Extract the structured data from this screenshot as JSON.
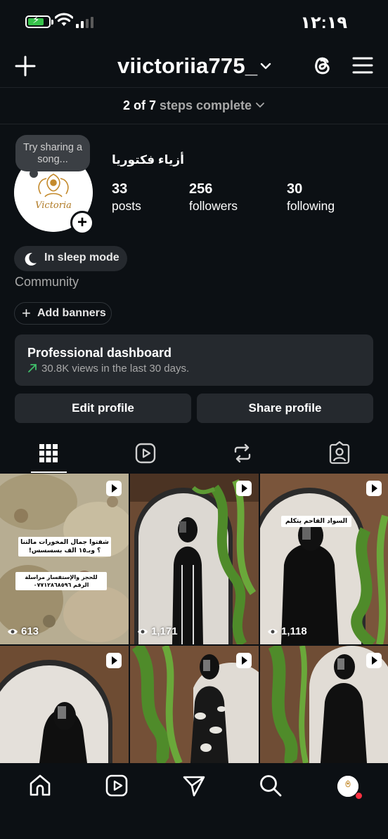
{
  "status_bar": {
    "time": "١٢:١٩"
  },
  "header": {
    "username": "viictoriia775_"
  },
  "steps": {
    "progress": "2 of 7",
    "suffix": "steps complete"
  },
  "profile": {
    "note": "Try sharing a song...",
    "logo_text": "Victoria",
    "full_name": "أزياء فكتوريا",
    "stats": [
      {
        "value": "33",
        "label": "posts"
      },
      {
        "value": "256",
        "label": "followers"
      },
      {
        "value": "30",
        "label": "following"
      }
    ],
    "sleep_mode": "In sleep mode",
    "category": "Community",
    "add_banners": "Add banners"
  },
  "dashboard": {
    "title": "Professional dashboard",
    "subtitle": "30.8K views in the last 30 days."
  },
  "buttons": {
    "edit": "Edit profile",
    "share": "Share profile"
  },
  "posts": [
    {
      "views": "613",
      "caption1": "شفتوا جمال المخورات مالتنا ؟ وبـ١٥ الف بسسسس!",
      "caption2": "للحجز والإستفسار مراسلة الرقم ٠٧٧١٢٨٦٨٥٩٦"
    },
    {
      "views": "1,171"
    },
    {
      "views": "1,118",
      "caption1": "السواد الفاحم يتكلم"
    },
    {
      "views": ""
    },
    {
      "views": ""
    },
    {
      "views": ""
    }
  ],
  "colors": {
    "background": "#0c1014",
    "surface": "#25292e",
    "accent_green": "#37c24b",
    "trend_green": "#3fbf6a",
    "notification": "#ff3040"
  }
}
